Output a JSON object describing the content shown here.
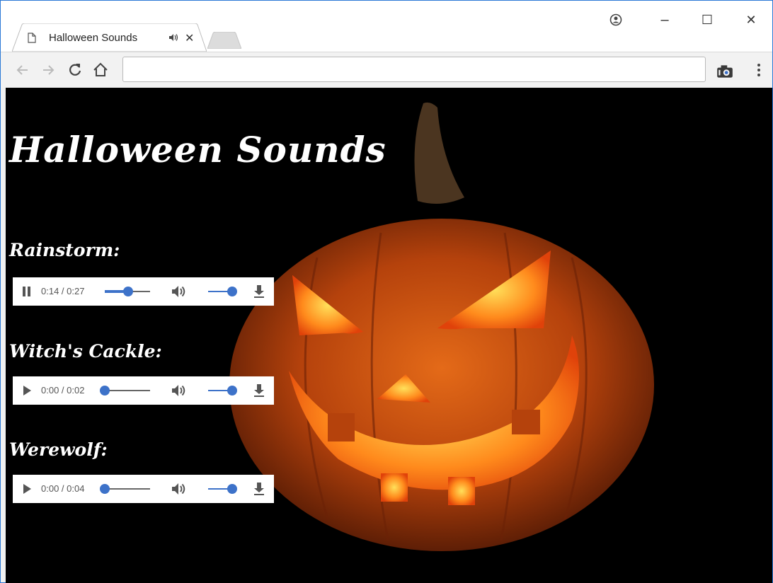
{
  "browser": {
    "tab_title": "Halloween Sounds",
    "address": "",
    "controls": {
      "account": "account-icon",
      "minimize": "–",
      "maximize": "☐",
      "close": "✕"
    }
  },
  "page": {
    "heading": "Halloween Sounds",
    "sounds": [
      {
        "label": "Rainstorm:",
        "state": "playing",
        "time": "0:14 / 0:27",
        "progress": 0.52,
        "volume": 1.0
      },
      {
        "label": "Witch's Cackle:",
        "state": "paused",
        "time": "0:00 / 0:02",
        "progress": 0.0,
        "volume": 1.0
      },
      {
        "label": "Werewolf:",
        "state": "paused",
        "time": "0:00 / 0:04",
        "progress": 0.0,
        "volume": 1.0
      }
    ]
  },
  "colors": {
    "accent": "#3d72c9",
    "page_bg": "#000000",
    "window_border": "#2b79d6"
  }
}
